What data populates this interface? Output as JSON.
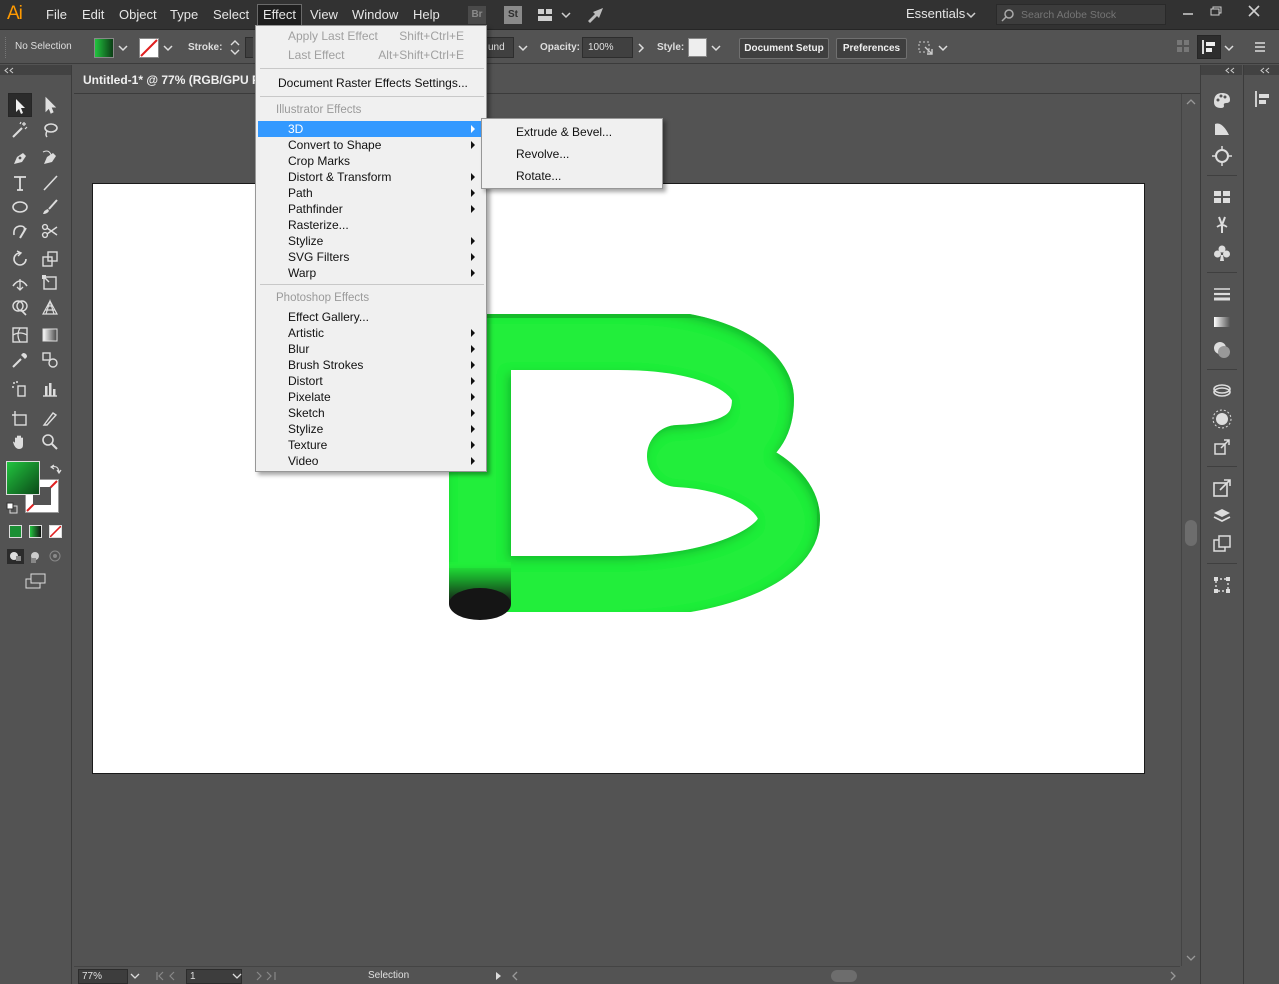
{
  "app": {
    "logo": "Ai",
    "menus": [
      "File",
      "Edit",
      "Object",
      "Type",
      "Select",
      "Effect",
      "View",
      "Window",
      "Help"
    ],
    "active_menu": "Effect",
    "bridge_label": "Br",
    "stock_label": "St",
    "workspace": "Essentials",
    "search_placeholder": "Search Adobe Stock"
  },
  "control_bar": {
    "selection_label": "No Selection",
    "fill_color": "#1a9e3a",
    "stroke_label": "Stroke:",
    "brush_label": "und",
    "opacity_label": "Opacity:",
    "opacity_value": "100%",
    "style_label": "Style:",
    "document_setup": "Document Setup",
    "preferences": "Preferences"
  },
  "document": {
    "tab_title": "Untitled-1* @ 77% (RGB/GPU Preview)",
    "zoom": "77%",
    "page": "1",
    "status": "Selection",
    "art_color": "#22ee3a",
    "art_shadow": "#1a1a1a"
  },
  "effect_menu": {
    "apply_last": "Apply Last Effect",
    "apply_last_shortcut": "Shift+Ctrl+E",
    "last_effect": "Last Effect",
    "last_effect_shortcut": "Alt+Shift+Ctrl+E",
    "raster_settings": "Document Raster Effects Settings...",
    "illustrator_section": "Illustrator Effects",
    "illustrator_items": [
      "3D",
      "Convert to Shape",
      "Crop Marks",
      "Distort & Transform",
      "Path",
      "Pathfinder",
      "Rasterize...",
      "Stylize",
      "SVG Filters",
      "Warp"
    ],
    "photoshop_section": "Photoshop Effects",
    "photoshop_items": [
      "Effect Gallery...",
      "Artistic",
      "Blur",
      "Brush Strokes",
      "Distort",
      "Pixelate",
      "Sketch",
      "Stylize",
      "Texture",
      "Video"
    ],
    "highlighted": "3D"
  },
  "submenu_3d": {
    "items": [
      "Extrude & Bevel...",
      "Revolve...",
      "Rotate..."
    ]
  }
}
